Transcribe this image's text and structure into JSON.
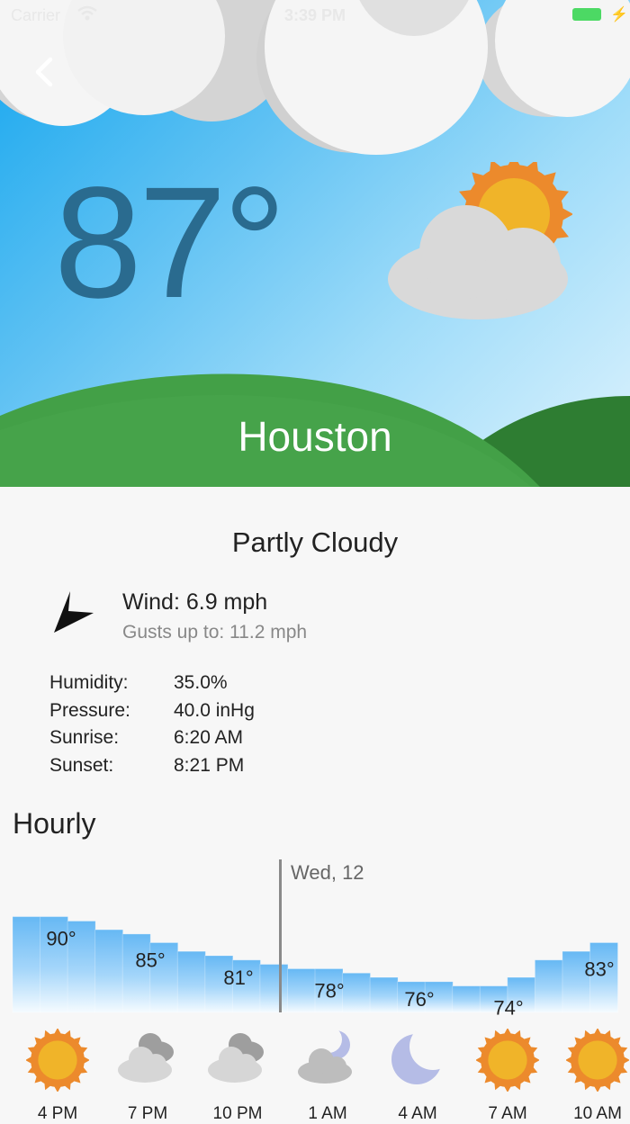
{
  "status_bar": {
    "carrier": "Carrier",
    "time": "3:39 PM"
  },
  "current": {
    "temperature": "87°",
    "city": "Houston",
    "condition": "Partly Cloudy",
    "icon": "partly-cloudy-day-icon"
  },
  "wind": {
    "speed": "Wind: 6.9 mph",
    "gusts": "Gusts up to: 11.2 mph",
    "icon": "wind-direction-arrow-icon"
  },
  "details": [
    {
      "label": "Humidity:",
      "value": "35.0%"
    },
    {
      "label": "Pressure:",
      "value": "40.0 inHg"
    },
    {
      "label": "Sunrise:",
      "value": "6:20 AM"
    },
    {
      "label": "Sunset:",
      "value": "8:21 PM"
    }
  ],
  "hourly": {
    "title": "Hourly",
    "day_label": "Wed, 12",
    "temp_labels": [
      "90°",
      "85°",
      "81°",
      "78°",
      "76°",
      "74°",
      "83°"
    ],
    "hours": [
      {
        "time": "4 PM",
        "icon": "sun-icon"
      },
      {
        "time": "7 PM",
        "icon": "cloudy-icon"
      },
      {
        "time": "10 PM",
        "icon": "cloudy-icon"
      },
      {
        "time": "1 AM",
        "icon": "partly-cloudy-night-icon"
      },
      {
        "time": "4 AM",
        "icon": "moon-icon"
      },
      {
        "time": "7 AM",
        "icon": "sun-icon"
      },
      {
        "time": "10 AM",
        "icon": "sun-icon"
      }
    ]
  },
  "colors": {
    "sky": "#14a6ee",
    "hill_light": "#43a047",
    "hill_dark": "#2e7d32",
    "sun": "#f0b429",
    "sun_ray": "#ec8a2c",
    "cloud": "#d9d9d9",
    "bar": "#7cc4f6"
  },
  "chart_data": {
    "type": "bar",
    "title": "Hourly",
    "temperature_unit": "°",
    "labeled_points": [
      {
        "time": "4 PM",
        "temp": 90
      },
      {
        "time": "7 PM",
        "temp": 85
      },
      {
        "time": "10 PM",
        "temp": 81
      },
      {
        "time": "1 AM",
        "temp": 78
      },
      {
        "time": "4 AM",
        "temp": 76
      },
      {
        "time": "7 AM",
        "temp": 74
      },
      {
        "time": "10 AM",
        "temp": 83
      }
    ],
    "values": [
      90,
      90,
      89,
      87,
      86,
      84,
      82,
      81,
      80,
      79,
      78,
      78,
      77,
      76,
      75,
      75,
      74,
      74,
      76,
      80,
      82,
      84
    ]
  }
}
